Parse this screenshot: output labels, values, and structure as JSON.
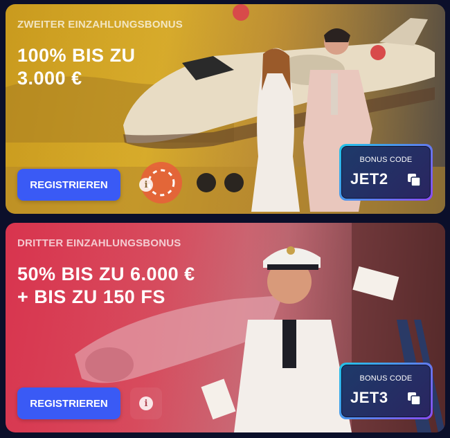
{
  "offers": [
    {
      "kicker": "ZWEITER EINZAHLUNGSBONUS",
      "headline": [
        "100% BIS ZU",
        "3.000 €"
      ],
      "register_label": "REGISTRIEREN",
      "info_icon": "i",
      "code_label": "BONUS CODE",
      "code": "JET2",
      "accent": "#c99a1e"
    },
    {
      "kicker": "DRITTER EINZAHLUNGSBONUS",
      "headline": [
        "50% BIS ZU 6.000 €",
        "+ BIS ZU 150 FS"
      ],
      "register_label": "REGISTRIEREN",
      "info_icon": "i",
      "code_label": "BONUS CODE",
      "code": "JET3",
      "accent": "#d8344e"
    }
  ],
  "colors": {
    "page_bg": "#0b0f2a",
    "button_blue": "#3a5af5",
    "code_gradient_start": "#22c4e8",
    "code_gradient_end": "#8a4bf0"
  },
  "icons": [
    "info-icon",
    "copy-icon",
    "casino-chip",
    "playing-card"
  ]
}
